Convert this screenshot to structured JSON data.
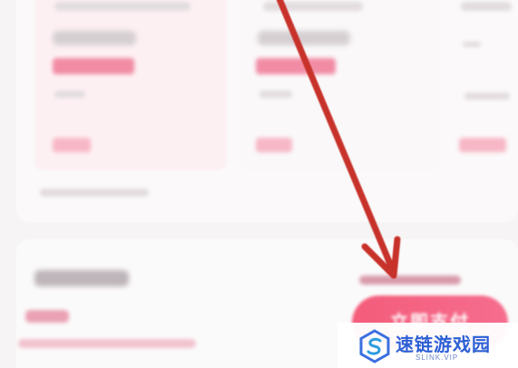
{
  "colors": {
    "accent": "#f45c7b",
    "arrow": "#c7332c",
    "watermark_blue": "#2d5fd5"
  },
  "pay": {
    "label": "立即支付"
  },
  "watermark": {
    "name": "速链游戏园",
    "sub": "SLINK.VIP",
    "logo_icon": "hexagon-s-logo"
  },
  "annotation": {
    "arrow_icon": "red-arrow-pointing-down-right"
  }
}
